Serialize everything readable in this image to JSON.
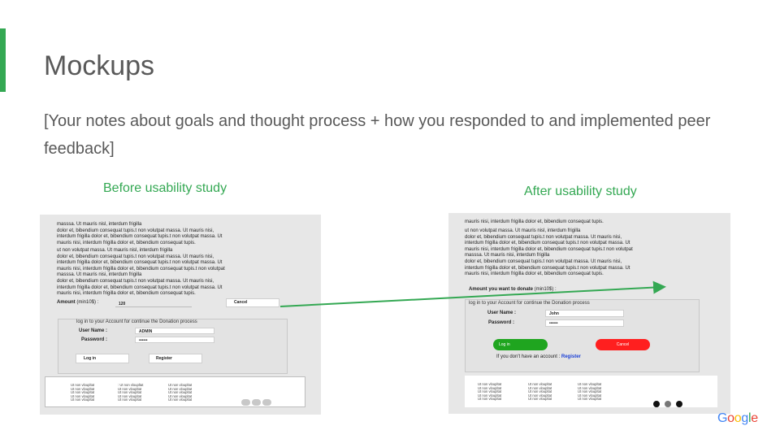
{
  "slide": {
    "title": "Mockups",
    "notes": "[Your notes about goals and thought process + how you responded to and implemented peer feedback]",
    "caption_before": "Before usability study",
    "caption_after": "After usability study",
    "accent_color": "#34a853"
  },
  "before": {
    "para1": [
      "masssa. Ut mauris nisl, interdum frigilla",
      "dolor et, bibendium  consequat tupis.t non volutpat massa. Ut mauris nisi,",
      "interdum frigilla  dolor et, bibendium  consequat tupis.t non volutpat massa. Ut",
      "mauris nisi, interdum frigilla  dolor et, bibendium  consequat tupis."
    ],
    "para2": [
      "ut non volutpat massa. Ut mauris nisl, interdum frigilla",
      "dolor et, bibendium  consequat tupis.t non volutpat massa. Ut mauris nisi,",
      "interdum frigilla  dolor et, bibendium  consequat tupis.t non volutpat massa. Ut",
      "mauris nisi, interdum frigilla  dolor et, bibendium  consequat tupis.t non volutpat",
      "masssa. Ut mauris nisi, interdum frigilla",
      "dolor et, bibendium  consequat tupis.t non volutpat massa. Ut mauris nisi,",
      "interdum frigilla  dolor et, bibendium  consequat tupis.t non volutpat massa. Ut",
      "mauris nisi, interdum frigilla  dolor et, bibendium  consequat tupis."
    ],
    "amount_label": "Amount",
    "amount_sub": "(min10$) :",
    "amount_value": "120",
    "cancel_label": "Cancel",
    "login_title": "log in  to your Account for continue the Donation process",
    "username_label": "User Name :",
    "username_value": "ADMIN",
    "password_label": "Password  :",
    "password_value": "••••••",
    "login_button": "Log in",
    "register_button": "Register",
    "footer_col1": [
      "Ut non vloupltat",
      "Ut non vloupltat",
      "Ut non vloupltat",
      "Ut non vloupltat",
      "Ut non vloupltat"
    ],
    "footer_col2": [
      ": Ut non vloupltat",
      "Ut non vloupltat",
      "Ut non vloupltat",
      "Ut non vloupltat",
      "Ut non vloupltat"
    ],
    "footer_col3": [
      "Ut non vloupltat",
      "Ut non vloupltat",
      "Ut non vloupltat",
      "Ut non vloupltat",
      "Ut non vloupltat"
    ]
  },
  "after": {
    "para1": [
      "mauris nisi, interdum frigilla  dolor et, bibendium  consequat tupis."
    ],
    "para2": [
      "ut non volutpat massa. Ut mauris nisl, interdum frigilla",
      "dolor et, bibendium  consequat tupis.t non volutpat massa. Ut mauris nisi,",
      "interdum frigilla  dolor et, bibendium  consequat tupis.t non volutpat massa. Ut",
      "mauris nisi, interdum frigilla  dolor et, bibendium  consequat tupis.t non volutpat",
      "masssa. Ut mauris nisi, interdum frigilla",
      "dolor et, bibendium  consequat tupis.t non volutpat massa. Ut mauris nisi,",
      "interdum frigilla  dolor et, bibendium  consequat tupis.t non volutpat massa. Ut",
      "mauris nisi, interdum frigilla  dolor et, bibendium  consequat tupis."
    ],
    "amount_label": "Amount you want to donate",
    "amount_sub": "(min10$) :",
    "login_title": "log in  to your Account for continue the Donation process",
    "username_label": "User Name :",
    "username_value": "John",
    "password_label": "Password  :",
    "password_value": "••••••",
    "login_button": "Log in",
    "cancel_button": "Cancel",
    "register_prompt": "If you don't have an account : ",
    "register_link": "Register",
    "footer_col1": [
      "Ut non vloupltat",
      "Ut non vloupltat",
      "Ut non vloupltat",
      "Ut non vloupltat",
      "Ut non vloupltat"
    ],
    "footer_col2": [
      "Ut non vloupltat",
      "Ut non vloupltat",
      "Ut non vloupltat",
      "Ut non vloupltat",
      "Ut non vloupltat"
    ],
    "footer_col3": [
      "Ut non vloupltat",
      "Ut non vloupltat",
      "Ut non vloupltat",
      "Ut non vloupltat",
      "Ut non vloupltat"
    ],
    "social_icons": [
      "facebook-icon",
      "instagram-icon",
      "twitter-icon"
    ]
  },
  "brand": {
    "logo_text": "Google",
    "letters": [
      "G",
      "o",
      "o",
      "g",
      "l",
      "e"
    ],
    "letter_colors": [
      "#4285f4",
      "#ea4335",
      "#fbbc05",
      "#4285f4",
      "#34a853",
      "#ea4335"
    ]
  },
  "arrow_color": "#34a853"
}
